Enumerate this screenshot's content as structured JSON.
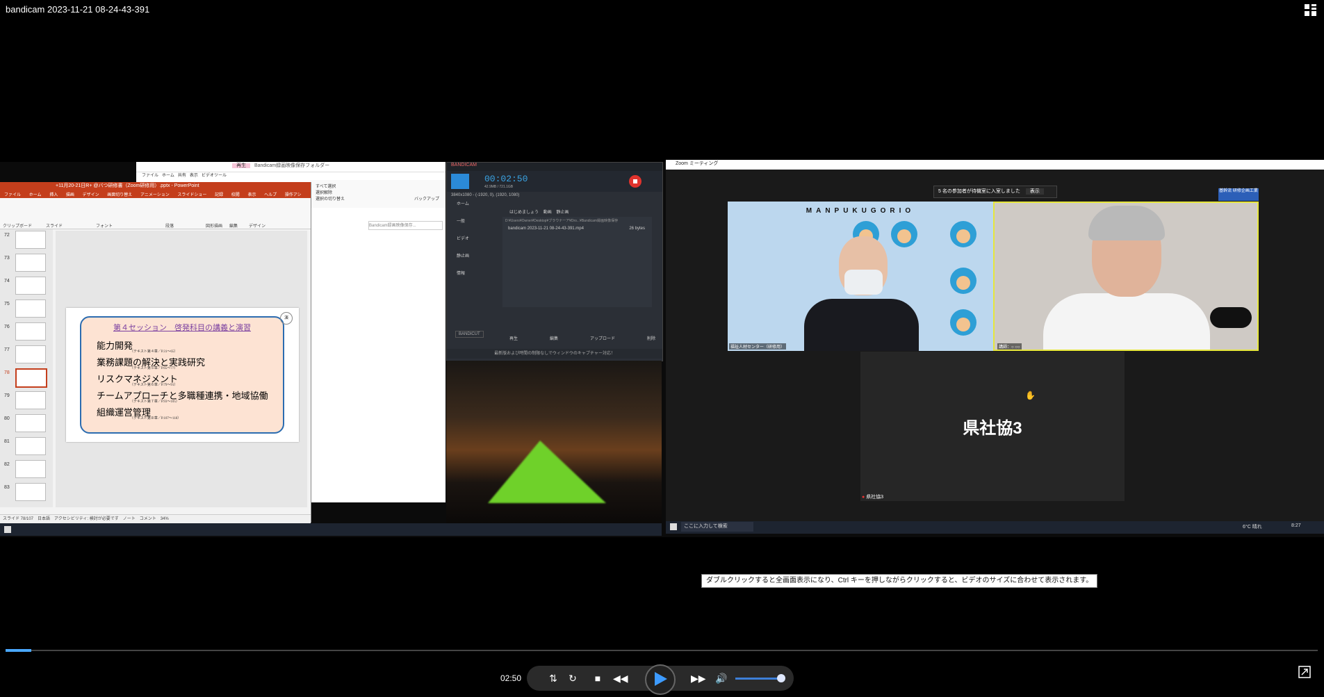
{
  "window": {
    "title": "bandicam 2023-11-21 08-24-43-391"
  },
  "powerpoint": {
    "titlebar": "+11月20-21日R+ @バつ研修書（Zoom研修用）.pptx - PowerPoint",
    "tabs": [
      "ファイル",
      "ホーム",
      "挿入",
      "描画",
      "デザイン",
      "画面切り替え",
      "アニメーション",
      "スライドショー",
      "記録",
      "校閲",
      "表示",
      "ヘルプ",
      "操作アシ"
    ],
    "ribbon_groups": [
      "クリップボード",
      "スライド",
      "フォント",
      "段落",
      "図形描画",
      "編集",
      "デザイン"
    ],
    "thumbnails": [
      {
        "num": "72"
      },
      {
        "num": "73"
      },
      {
        "num": "74"
      },
      {
        "num": "75"
      },
      {
        "num": "76"
      },
      {
        "num": "77"
      },
      {
        "num": "78"
      },
      {
        "num": "79"
      },
      {
        "num": "80"
      },
      {
        "num": "81"
      },
      {
        "num": "82"
      },
      {
        "num": "83"
      }
    ],
    "selected_thumbnail": "78",
    "slide": {
      "title": "第４セッション　啓発科目の講義と演習",
      "badge": "演",
      "lines": [
        {
          "text": "能力開発",
          "sub": "（テキスト第４章／P.31〜65）"
        },
        {
          "text": "業務課題の解決と実践研究",
          "sub": "（テキスト第５章／P.65〜77）"
        },
        {
          "text": "リスクマネジメント",
          "sub": "（テキスト第６章／P.79〜91）"
        },
        {
          "text": "チームアプローチと多職種連携・地域協働",
          "sub": "（テキスト第７章／P.93〜105）"
        },
        {
          "text": "組織運営管理",
          "sub": "（テキスト第８章／P.107〜118）"
        }
      ]
    },
    "status": "スライド 78/107　日本語　アクセシビリティ: 検討が必要です　ノート　コメント　34%"
  },
  "explorer": {
    "title_highlight": "再生",
    "title": "Bandicam録画映像保存フォルダー",
    "tabs": [
      "ファイル",
      "ホーム",
      "共有",
      "表示",
      "ビデオツール"
    ],
    "ribbon": [
      "すべて選択",
      "選択解除",
      "選択の切り替え",
      "バックアップ"
    ],
    "search_placeholder": "Bandicam録画映像保存..."
  },
  "bandicam": {
    "brand": "BANDICAM",
    "time": "00:02:50",
    "size": "42.9MB / 721.1GB",
    "region": "3840x1080 - (-1920, 0), (1920, 1080)",
    "sidebar": [
      "ホーム",
      "一般",
      "ビデオ",
      "静止画",
      "情報"
    ],
    "tabs": [
      "はじめましょう",
      "動画",
      "静止画"
    ],
    "path": "D:¥Users¥Owner¥Desktop¥ブラウナーア¥Dro...¥Bandicam録画映像保存",
    "file_name": "bandicam 2023-11-21 08-24-43-391.mp4",
    "file_size": "26 bytes",
    "buttons": [
      "再生",
      "編集",
      "アップロード",
      "削除"
    ],
    "logo": "BANDICUT",
    "footer": "最新版および時間の制限なしでウィンドウのキャプチャー対応！"
  },
  "zoom": {
    "title": "Zoom ミーティング",
    "notification": "5 名の参加者が待機室に入室しました",
    "notification_button": "表示",
    "tag": "基幹流 研修企画工業",
    "video1_banner": "MANPUKUGORIO",
    "video1_label": "福祉人材センター（研修用）",
    "video2_label": "講師：○ ○○",
    "video3_name": "県社協3",
    "video3_label": "県社協3",
    "taskbar_search": "ここに入力して検索",
    "taskbar_time": "8:27",
    "taskbar_weather": "6°C 晴れ"
  },
  "player": {
    "tooltip": "ダブルクリックすると全画面表示になり、Ctrl キーを押しながらクリックすると、ビデオのサイズに合わせて表示されます。",
    "time": "02:50",
    "progress": 0.02,
    "volume": 0.85
  }
}
